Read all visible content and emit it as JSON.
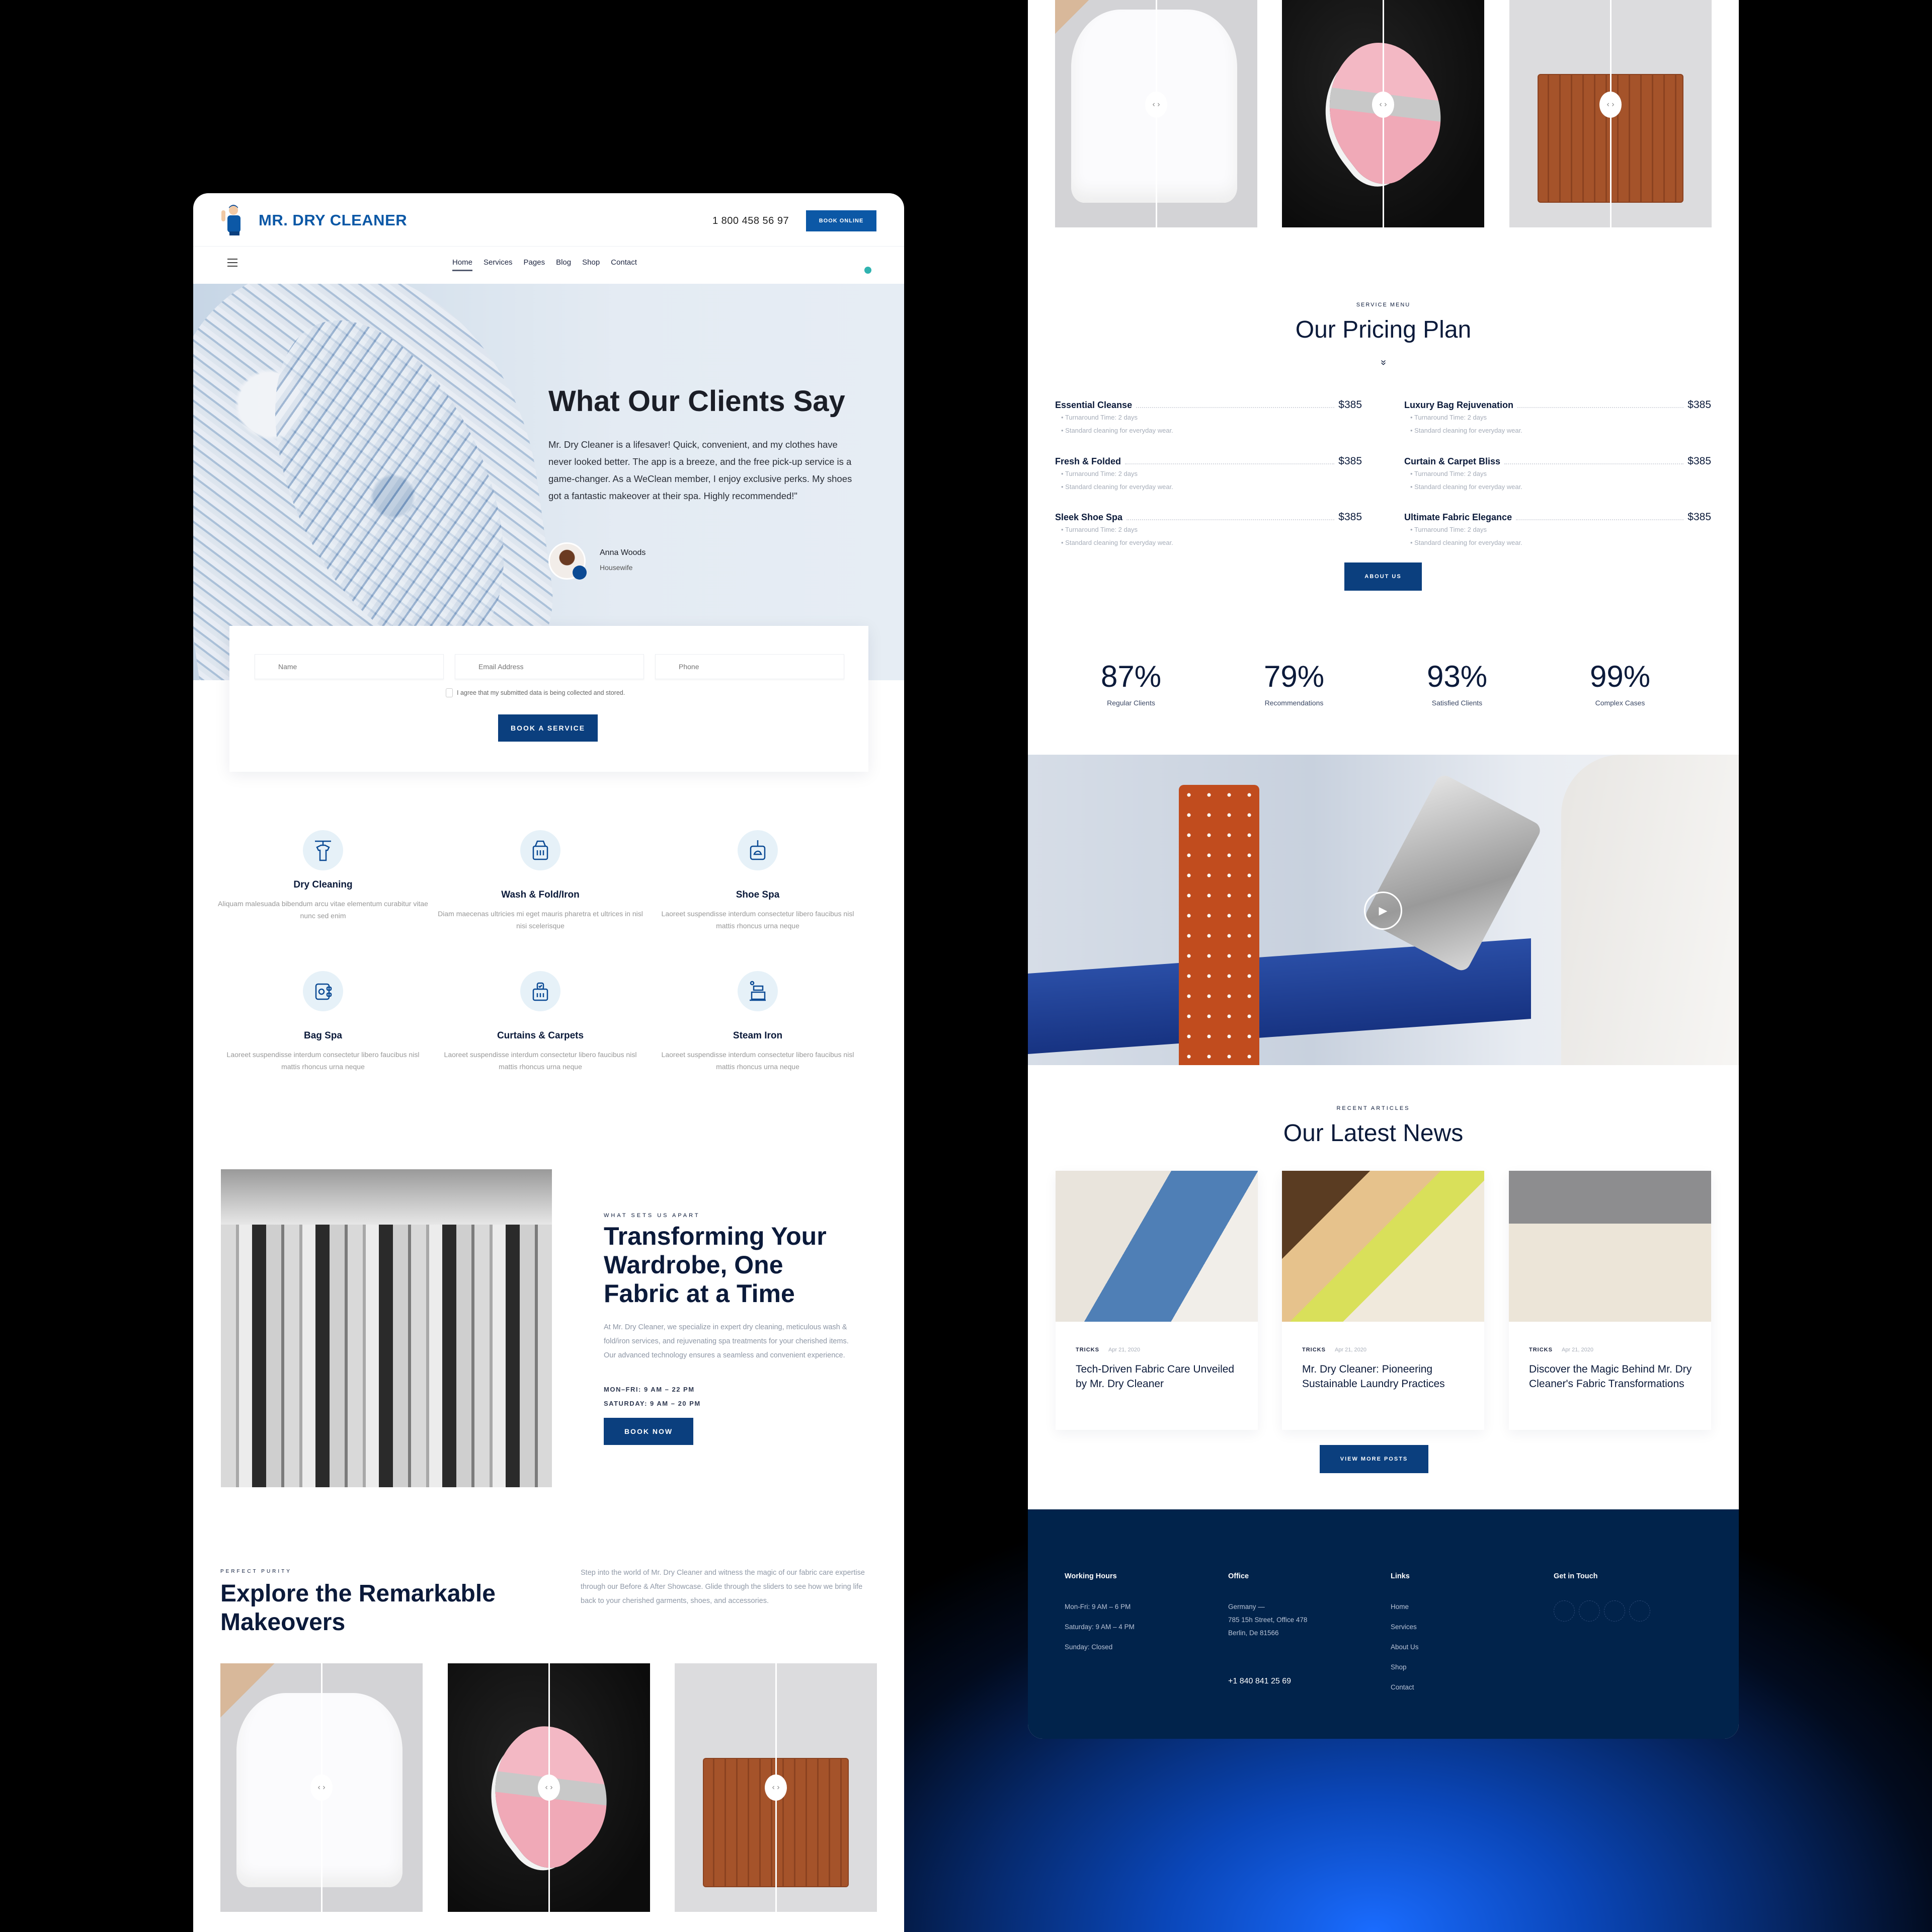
{
  "brand": {
    "name": "MR. DRY CLEANER",
    "phone": "1 800 458 56 97",
    "book_online": "BOOK ONLINE",
    "accent": "#0b3f7e",
    "logo_blue": "#0c58a6",
    "footer_bg": "#01234b"
  },
  "nav": {
    "items": [
      "Home",
      "Services",
      "Pages",
      "Blog",
      "Shop",
      "Contact"
    ],
    "active": "Home"
  },
  "testimonial": {
    "title": "What Our Clients Say",
    "quote": "Mr. Dry Cleaner is a lifesaver! Quick, convenient, and my clothes have never looked better. The app is a breeze, and the free pick-up service is a game-changer. As a WeClean member, I enjoy exclusive perks. My shoes got a fantastic makeover at their spa. Highly recommended!\"",
    "author": "Anna Woods",
    "role": "Housewife"
  },
  "booking_form": {
    "name_placeholder": "Name",
    "email_placeholder": "Email Address",
    "phone_placeholder": "Phone",
    "consent": "I agree that my submitted data is being collected and stored.",
    "submit": "BOOK A SERVICE"
  },
  "services": [
    {
      "title": "Dry Cleaning",
      "desc": "Aliquam malesuada bibendum arcu vitae elementum curabitur vitae nunc sed enim",
      "icon": "hanging-shirt-icon"
    },
    {
      "title": "Wash & Fold/Iron",
      "desc": "Diam maecenas ultricies mi eget mauris pharetra et ultrices in nisl nisi scelerisque",
      "icon": "washing-machine-icon"
    },
    {
      "title": "Shoe Spa",
      "desc": "Laoreet suspendisse interdum consectetur libero faucibus nisl mattis rhoncus urna neque",
      "icon": "shoe-spa-icon"
    },
    {
      "title": "Bag Spa",
      "desc": "Laoreet suspendisse interdum consectetur libero faucibus nisl mattis rhoncus urna neque",
      "icon": "bag-spa-icon"
    },
    {
      "title": "Curtains & Carpets",
      "desc": "Laoreet suspendisse interdum consectetur libero faucibus nisl mattis rhoncus urna neque",
      "icon": "curtain-carpet-icon"
    },
    {
      "title": "Steam Iron",
      "desc": "Laoreet suspendisse interdum consectetur libero faucibus nisl mattis rhoncus urna neque",
      "icon": "steam-iron-icon"
    }
  ],
  "about": {
    "eyebrow": "WHAT SETS US APART",
    "title": "Transforming Your Wardrobe, One Fabric at a Time",
    "body": "At Mr. Dry Cleaner, we specialize in expert dry cleaning, meticulous wash & fold/iron services, and rejuvenating spa treatments for your cherished items. Our advanced technology ensures a seamless and convenient experience.",
    "hours_weekday": "MON–FRI: 9 AM – 22 PM",
    "hours_saturday": "SATURDAY: 9 AM – 20 PM",
    "cta": "BOOK NOW"
  },
  "makeovers": {
    "eyebrow": "PERFECT PURITY",
    "title": "Explore the Remarkable Makeovers",
    "desc": "Step into the world of Mr. Dry Cleaner and witness the magic of our fabric care expertise through our Before & After Showcase. Glide through the sliders to see how we bring life back to your cherished garments, shoes, and accessories.",
    "items": [
      {
        "label": "sweatshirt",
        "handle": "‹ ›"
      },
      {
        "label": "sneaker",
        "handle": "‹ ›"
      },
      {
        "label": "leather-bag",
        "handle": "‹ ›"
      }
    ]
  },
  "pricing": {
    "eyebrow": "SERVICE MENU",
    "title": "Our Pricing Plan",
    "chevron": "»",
    "items": [
      {
        "name": "Essential Cleanse",
        "price": "$385",
        "turnaround": "Turnaround Time: 2 days",
        "note": "Standard cleaning for everyday wear."
      },
      {
        "name": "Luxury Bag Rejuvenation",
        "price": "$385",
        "turnaround": "Turnaround Time: 2 days",
        "note": "Standard cleaning for everyday wear."
      },
      {
        "name": "Fresh & Folded",
        "price": "$385",
        "turnaround": "Turnaround Time: 2 days",
        "note": "Standard cleaning for everyday wear."
      },
      {
        "name": "Curtain & Carpet Bliss",
        "price": "$385",
        "turnaround": "Turnaround Time: 2 days",
        "note": "Standard cleaning for everyday wear."
      },
      {
        "name": "Sleek Shoe Spa",
        "price": "$385",
        "turnaround": "Turnaround Time: 2 days",
        "note": "Standard cleaning for everyday wear."
      },
      {
        "name": "Ultimate Fabric Elegance",
        "price": "$385",
        "turnaround": "Turnaround Time: 2 days",
        "note": "Standard cleaning for everyday wear."
      }
    ],
    "cta": "ABOUT US"
  },
  "stats": [
    {
      "value": "87%",
      "label": "Regular Clients"
    },
    {
      "value": "79%",
      "label": "Recommendations"
    },
    {
      "value": "93%",
      "label": "Satisfied Clients"
    },
    {
      "value": "99%",
      "label": "Complex Cases"
    }
  ],
  "video": {
    "play_icon": "▶"
  },
  "news": {
    "eyebrow": "RECENT ARTICLES",
    "title": "Our Latest News",
    "posts": [
      {
        "category": "TRICKS",
        "date": "Apr 21, 2020",
        "title": "Tech-Driven Fabric Care Unveiled by Mr. Dry Cleaner"
      },
      {
        "category": "TRICKS",
        "date": "Apr 21, 2020",
        "title": "Mr. Dry Cleaner: Pioneering Sustainable Laundry Practices"
      },
      {
        "category": "TRICKS",
        "date": "Apr 21, 2020",
        "title": "Discover the Magic Behind Mr. Dry Cleaner's Fabric Transformations"
      }
    ],
    "cta": "VIEW MORE POSTS"
  },
  "footer": {
    "working_hours": {
      "title": "Working Hours",
      "lines": [
        "Mon-Fri: 9 AM – 6 PM",
        "Saturday: 9 AM – 4 PM",
        "Sunday: Closed"
      ]
    },
    "office": {
      "title": "Office",
      "lines": [
        "Germany —",
        "785 15h Street, Office 478",
        "Berlin, De 81566"
      ],
      "phone": "+1 840 841 25 69"
    },
    "links": {
      "title": "Links",
      "items": [
        "Home",
        "Services",
        "About Us",
        "Shop",
        "Contact"
      ]
    },
    "contact": {
      "title": "Get in Touch",
      "social_count": "4"
    }
  }
}
